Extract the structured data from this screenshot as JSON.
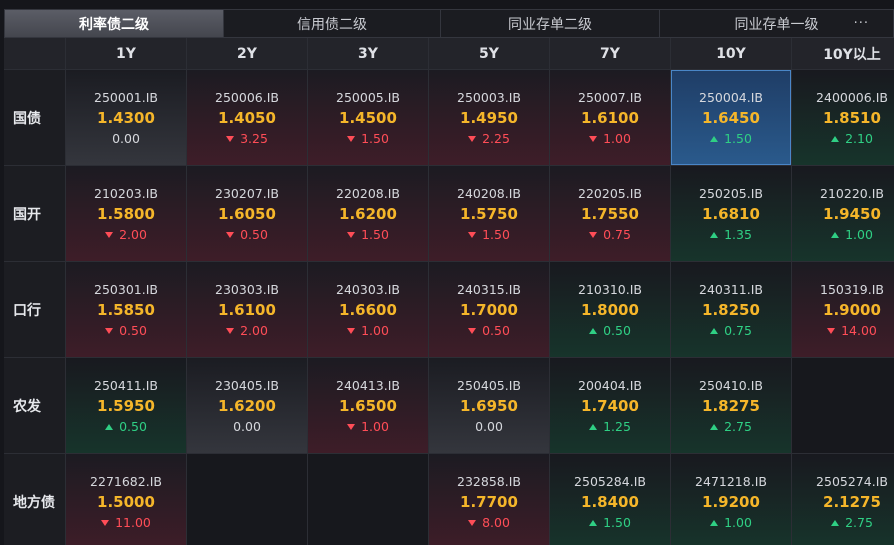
{
  "tabs": [
    {
      "label": "利率债二级",
      "active": true
    },
    {
      "label": "信用债二级",
      "active": false
    },
    {
      "label": "同业存单二级",
      "active": false
    },
    {
      "label": "同业存单一级",
      "active": false
    }
  ],
  "more_label": "···",
  "columns": [
    "1Y",
    "2Y",
    "3Y",
    "5Y",
    "7Y",
    "10Y",
    "10Y以上"
  ],
  "rows": [
    {
      "label": "国债",
      "cells": [
        {
          "code": "250001.IB",
          "price": "1.4300",
          "change": "0.00",
          "dir": "zero"
        },
        {
          "code": "250006.IB",
          "price": "1.4050",
          "change": "3.25",
          "dir": "down"
        },
        {
          "code": "250005.IB",
          "price": "1.4500",
          "change": "1.50",
          "dir": "down"
        },
        {
          "code": "250003.IB",
          "price": "1.4950",
          "change": "2.25",
          "dir": "down"
        },
        {
          "code": "250007.IB",
          "price": "1.6100",
          "change": "1.00",
          "dir": "down"
        },
        {
          "code": "250004.IB",
          "price": "1.6450",
          "change": "1.50",
          "dir": "up",
          "selected": true
        },
        {
          "code": "2400006.IB",
          "price": "1.8510",
          "change": "2.10",
          "dir": "up"
        }
      ]
    },
    {
      "label": "国开",
      "cells": [
        {
          "code": "210203.IB",
          "price": "1.5800",
          "change": "2.00",
          "dir": "down"
        },
        {
          "code": "230207.IB",
          "price": "1.6050",
          "change": "0.50",
          "dir": "down"
        },
        {
          "code": "220208.IB",
          "price": "1.6200",
          "change": "1.50",
          "dir": "down"
        },
        {
          "code": "240208.IB",
          "price": "1.5750",
          "change": "1.50",
          "dir": "down"
        },
        {
          "code": "220205.IB",
          "price": "1.7550",
          "change": "0.75",
          "dir": "down"
        },
        {
          "code": "250205.IB",
          "price": "1.6810",
          "change": "1.35",
          "dir": "up"
        },
        {
          "code": "210220.IB",
          "price": "1.9450",
          "change": "1.00",
          "dir": "up"
        }
      ]
    },
    {
      "label": "口行",
      "cells": [
        {
          "code": "250301.IB",
          "price": "1.5850",
          "change": "0.50",
          "dir": "down"
        },
        {
          "code": "230303.IB",
          "price": "1.6100",
          "change": "2.00",
          "dir": "down"
        },
        {
          "code": "240303.IB",
          "price": "1.6600",
          "change": "1.00",
          "dir": "down"
        },
        {
          "code": "240315.IB",
          "price": "1.7000",
          "change": "0.50",
          "dir": "down"
        },
        {
          "code": "210310.IB",
          "price": "1.8000",
          "change": "0.50",
          "dir": "up"
        },
        {
          "code": "240311.IB",
          "price": "1.8250",
          "change": "0.75",
          "dir": "up"
        },
        {
          "code": "150319.IB",
          "price": "1.9000",
          "change": "14.00",
          "dir": "down"
        }
      ]
    },
    {
      "label": "农发",
      "cells": [
        {
          "code": "250411.IB",
          "price": "1.5950",
          "change": "0.50",
          "dir": "up"
        },
        {
          "code": "230405.IB",
          "price": "1.6200",
          "change": "0.00",
          "dir": "zero"
        },
        {
          "code": "240413.IB",
          "price": "1.6500",
          "change": "1.00",
          "dir": "down"
        },
        {
          "code": "250405.IB",
          "price": "1.6950",
          "change": "0.00",
          "dir": "zero"
        },
        {
          "code": "200404.IB",
          "price": "1.7400",
          "change": "1.25",
          "dir": "up"
        },
        {
          "code": "250410.IB",
          "price": "1.8275",
          "change": "2.75",
          "dir": "up"
        },
        null
      ]
    },
    {
      "label": "地方债",
      "cells": [
        {
          "code": "2271682.IB",
          "price": "1.5000",
          "change": "11.00",
          "dir": "down"
        },
        null,
        null,
        {
          "code": "232858.IB",
          "price": "1.7700",
          "change": "8.00",
          "dir": "down"
        },
        {
          "code": "2505284.IB",
          "price": "1.8400",
          "change": "1.50",
          "dir": "up"
        },
        {
          "code": "2471218.IB",
          "price": "1.9200",
          "change": "1.00",
          "dir": "up"
        },
        {
          "code": "2505274.IB",
          "price": "2.1275",
          "change": "2.75",
          "dir": "up"
        }
      ]
    }
  ]
}
